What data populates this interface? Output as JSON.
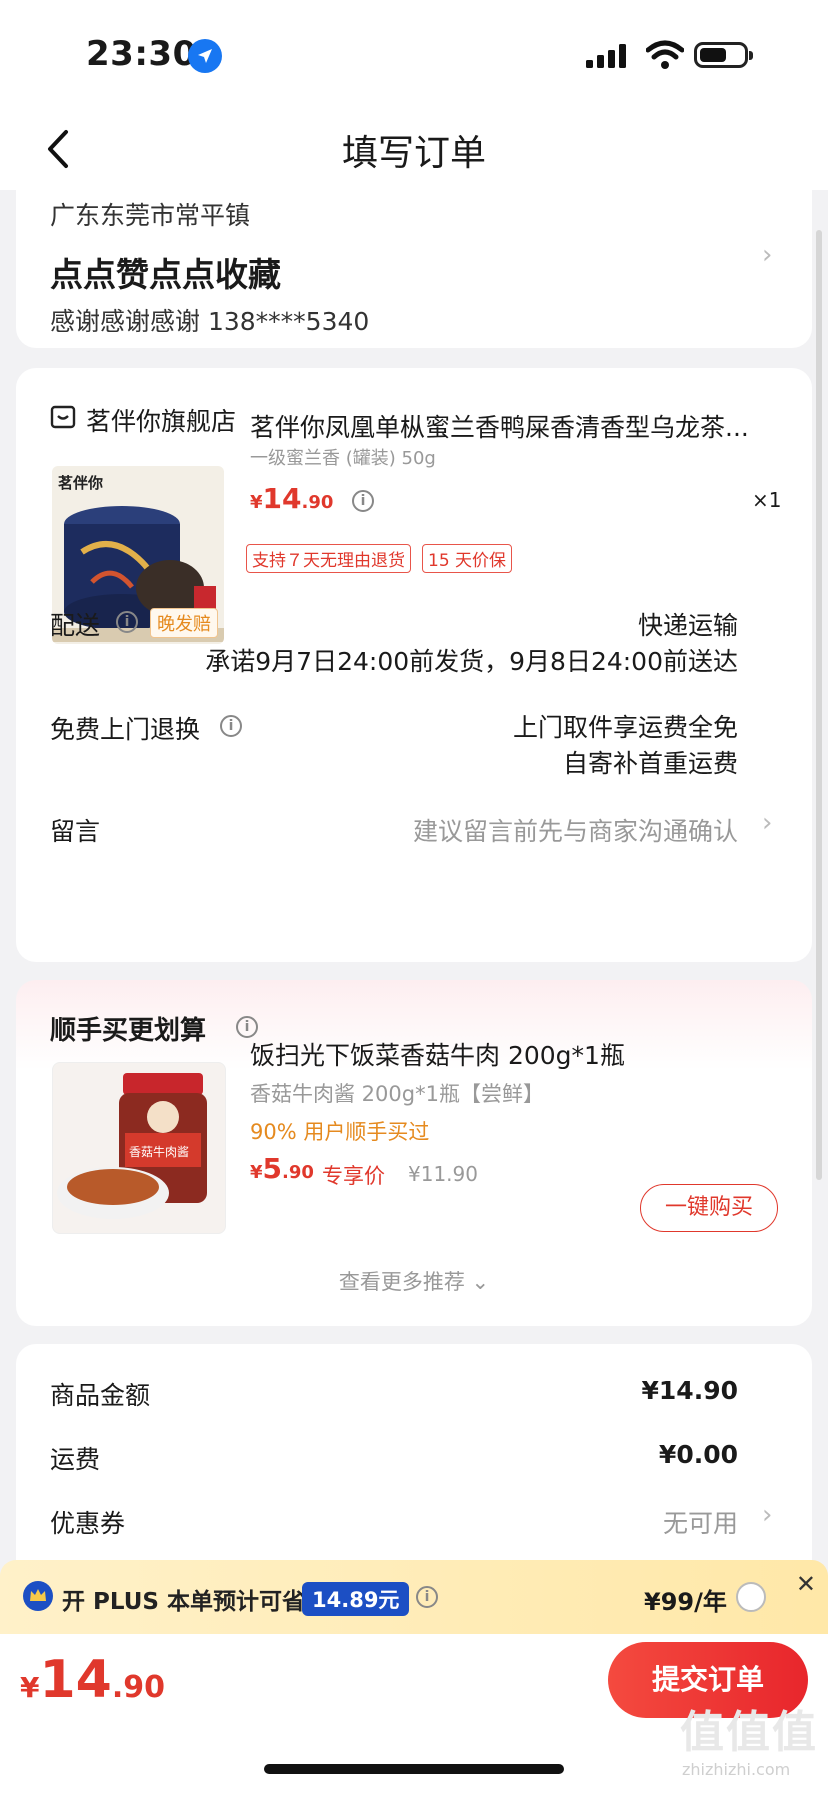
{
  "status_bar": {
    "time": "23:30"
  },
  "nav": {
    "title": "填写订单"
  },
  "address": {
    "region": "广东东莞市常平镇",
    "detail": "点点赞点点收藏",
    "contact": "感谢感谢感谢  138****5340"
  },
  "store": {
    "name": "茗伴你旗舰店"
  },
  "product": {
    "brand_on_image": "茗伴你",
    "title": "茗伴你凤凰单枞蜜兰香鸭屎香清香型乌龙茶...",
    "spec": "一级蜜兰香 (罐装) 50g",
    "currency": "¥",
    "price_int": "14",
    "price_dec": ".90",
    "qty": "×1",
    "tags": [
      "支持７天无理由退货",
      "15 天价保"
    ]
  },
  "delivery": {
    "label": "配送",
    "badge": "晚发赔",
    "method": "快递运输",
    "promise": "承诺9月7日24:00前发货，9月8日24:00前送达"
  },
  "free_return": {
    "label": "免费上门退换",
    "line1": "上门取件享运费全免",
    "line2": "自寄补首重运费"
  },
  "message": {
    "label": "留言",
    "placeholder": "建议留言前先与商家沟通确认"
  },
  "recommend": {
    "section_title": "顺手买更划算",
    "title": "饭扫光下饭菜香菇牛肉 200g*1瓶",
    "subtitle": "香菇牛肉酱 200g*1瓶【尝鲜】",
    "social": "90% 用户顺手买过",
    "currency": "¥",
    "price_int": "5",
    "price_dec": ".90",
    "price_tag": "专享价",
    "original": "¥11.90",
    "buy_button": "一键购买",
    "more": "查看更多推荐",
    "jar_label": "香菇牛肉酱"
  },
  "summary": {
    "rows": [
      {
        "label": "商品金额",
        "value": "¥14.90"
      },
      {
        "label": "运费",
        "value": "¥0.00"
      },
      {
        "label": "优惠券",
        "value": "无可用"
      }
    ]
  },
  "plus": {
    "text": "开 PLUS 本单预计可省",
    "amount": "14.89元",
    "price": "¥99/年"
  },
  "bottom": {
    "currency": "¥",
    "total_int": "14",
    "total_dec": ".90",
    "submit": "提交订单"
  },
  "watermark": {
    "text": "值值值",
    "sub": "zhizhizhi.com"
  },
  "colors": {
    "accent": "#e0382c",
    "plus_badge": "#1c4fc4",
    "gold": "#e58a1f"
  }
}
